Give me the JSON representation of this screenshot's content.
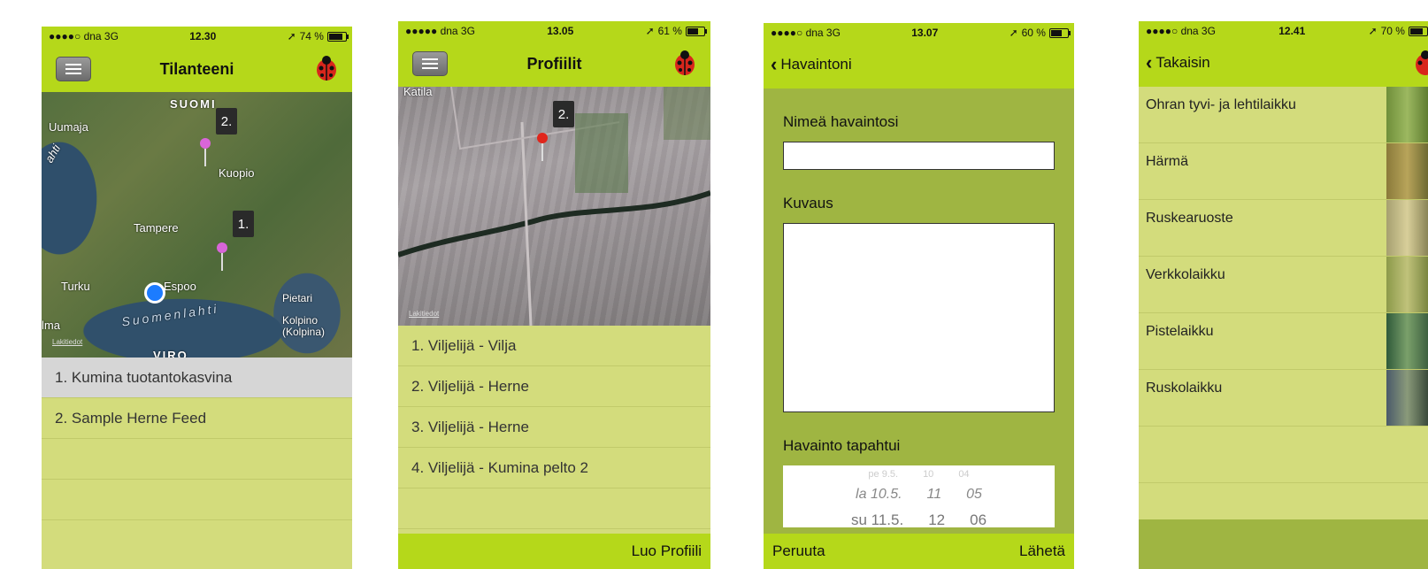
{
  "screens": [
    {
      "status": {
        "signal": "●●●●○ dna  3G",
        "time": "12.30",
        "battery": "74 %"
      },
      "title": "Tilanteeni",
      "map_labels": {
        "suomi": "SUOMI",
        "uumaja": "Uumaja",
        "ahti": "ahti",
        "kuopio": "Kuopio",
        "tampere": "Tampere",
        "turku": "Turku",
        "espoo": "Espoo",
        "suomenlahti": "Suomenlahti",
        "pietari": "Pietari",
        "kolpino": "Kolpino (Kolpina)",
        "elma": "lma",
        "viro": "VIRO",
        "legal": "Lakitiedot"
      },
      "pins": [
        "2.",
        "1."
      ],
      "items": [
        "1. Kumina tuotantokasvina",
        "2. Sample Herne Feed",
        "",
        ""
      ]
    },
    {
      "status": {
        "signal": "●●●●● dna  3G",
        "time": "13.05",
        "battery": "61 %"
      },
      "title": "Profiilit",
      "map_labels": {
        "katila": "Katila",
        "legal": "Lakitiedot"
      },
      "pins": [
        "2."
      ],
      "items": [
        "1. Viljelijä - Vilja",
        "2. Viljelijä - Herne",
        "3. Viljelijä - Herne",
        "4. Viljelijä - Kumina pelto 2",
        ""
      ],
      "footer_button": "Luo Profiili"
    },
    {
      "status": {
        "signal": "●●●●○ dna  3G",
        "time": "13.07",
        "battery": "60 %"
      },
      "back_label": "Havaintoni",
      "name_label": "Nimeä havaintosi",
      "desc_label": "Kuvaus",
      "date_label": "Havainto tapahtui",
      "picker_rows": [
        {
          "day": "pe 9.5.",
          "h": "10",
          "m": "04"
        },
        {
          "day": "la 10.5.",
          "h": "11",
          "m": "05"
        },
        {
          "day": "su 11.5.",
          "h": "12",
          "m": "06"
        }
      ],
      "cancel": "Peruuta",
      "send": "Lähetä"
    },
    {
      "status": {
        "signal": "●●●●○ dna  3G",
        "time": "12.41",
        "battery": "70 %"
      },
      "back_label": "Takaisin",
      "items": [
        "Ohran tyvi- ja lehtilaikku",
        "Härmä",
        "Ruskearuoste",
        "Verkkolaikku",
        "Pistelaikku",
        "Ruskolaikku",
        ""
      ]
    }
  ],
  "colors": {
    "accent": "#b5d81a",
    "list_bg": "#d3dc7c",
    "form_bg": "#9fb542"
  }
}
